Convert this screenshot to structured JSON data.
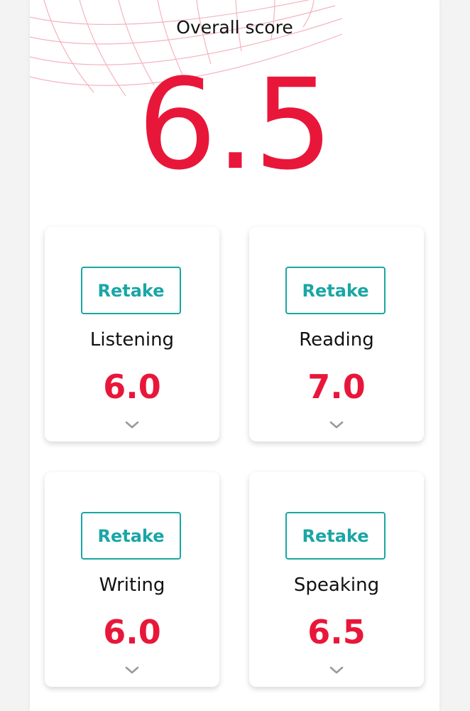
{
  "overall": {
    "title": "Overall score",
    "score": "6.5"
  },
  "sections": [
    {
      "label": "Listening",
      "score": "6.0",
      "retake_label": "Retake"
    },
    {
      "label": "Reading",
      "score": "7.0",
      "retake_label": "Retake"
    },
    {
      "label": "Writing",
      "score": "6.0",
      "retake_label": "Retake"
    },
    {
      "label": "Speaking",
      "score": "6.5",
      "retake_label": "Retake"
    }
  ],
  "colors": {
    "score_red": "#e8173a",
    "retake_teal": "#1aa6a5"
  },
  "icons": {
    "expand": "chevron-down-icon"
  }
}
